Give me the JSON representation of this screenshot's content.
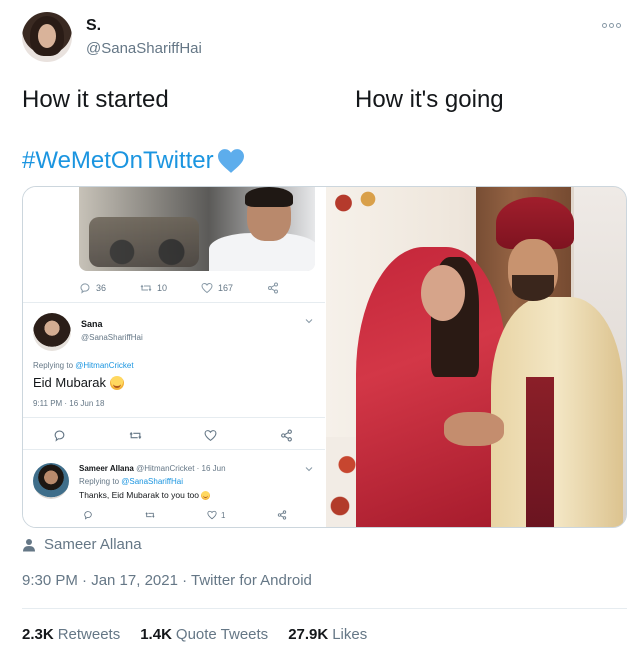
{
  "author": {
    "display_name": "S.",
    "handle": "@SanaShariffHai"
  },
  "tweet": {
    "caption_left": "How it started",
    "caption_right": "How it's going",
    "hashtag": "#WeMetOnTwitter",
    "heart_icon": "blue-heart-icon"
  },
  "embedded_screenshot": {
    "top_stats": {
      "replies": "36",
      "retweets": "10",
      "likes": "167"
    },
    "reply1": {
      "name": "Sana",
      "handle": "@SanaShariffHai",
      "replying_prefix": "Replying to ",
      "replying_handle": "@HitmanCricket",
      "text": "Eid Mubarak",
      "time": "9:11 PM · 16 Jun 18"
    },
    "reply2": {
      "name": "Sameer Allana",
      "meta": " @HitmanCricket · 16 Jun",
      "replying_prefix": "Replying to ",
      "replying_handle": "@SanaShariffHai",
      "text": "Thanks, Eid Mubarak to you too",
      "likes": "1"
    }
  },
  "tagged_user": "Sameer Allana",
  "meta_line": "9:30 PM · Jan 17, 2021 · Twitter for Android",
  "stats": {
    "retweets_count": "2.3K",
    "retweets_label": "Retweets",
    "quotes_count": "1.4K",
    "quotes_label": "Quote Tweets",
    "likes_count": "27.9K",
    "likes_label": "Likes"
  },
  "colors": {
    "link_blue": "#1b95e0",
    "muted": "#657786",
    "text": "#14171a",
    "border": "#ccd6dd"
  }
}
